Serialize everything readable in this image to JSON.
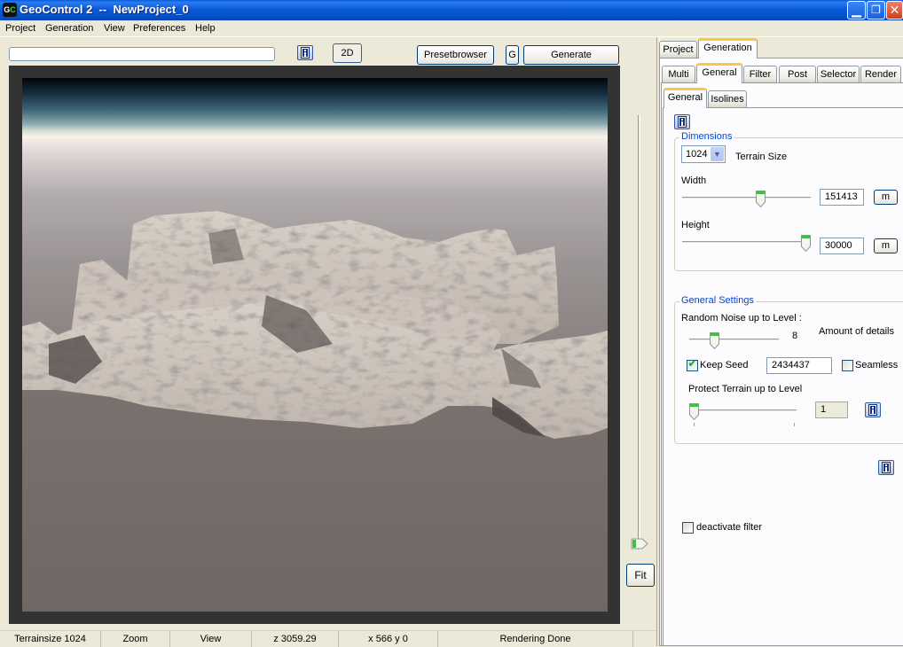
{
  "window": {
    "title": "GeoControl 2  --  NewProject_0",
    "app_icon": "geocontrol-logo-icon",
    "controls": [
      "minimize-icon",
      "restore-icon",
      "close-icon"
    ]
  },
  "menu": {
    "items": [
      {
        "label": "Project"
      },
      {
        "label": "Generation"
      },
      {
        "label": "View"
      },
      {
        "label": "Preferences"
      },
      {
        "label": "Help"
      }
    ]
  },
  "toolbar": {
    "progress_value": "",
    "info_icon": "info-icon",
    "mode_2d_label": "2D",
    "presetbrowser_label": "Presetbrowser",
    "g_label": "G",
    "generate_label": "Generate"
  },
  "viewport": {
    "fit_label": "Fit",
    "colors": {
      "frame": "#333333",
      "sky_top": "#02050c",
      "horizon": "#f8f2ea",
      "ground": "#6f6764",
      "terrain_light": "#d9d0c8",
      "terrain_shadow": "#5a5250"
    }
  },
  "panel": {
    "top_tabs": [
      {
        "label": "Project",
        "active": false
      },
      {
        "label": "Generation",
        "active": true
      }
    ],
    "sub_tabs": [
      {
        "label": "Multi",
        "active": false
      },
      {
        "label": "General",
        "active": true
      },
      {
        "label": "Filter",
        "active": false
      },
      {
        "label": "Post",
        "active": false
      },
      {
        "label": "Selector",
        "active": false
      },
      {
        "label": "Render",
        "active": false
      }
    ],
    "inner_tabs": [
      {
        "label": "General",
        "active": true
      },
      {
        "label": "Isolines",
        "active": false
      }
    ],
    "dimensions": {
      "title": "Dimensions",
      "terrain_size_value": "1024",
      "terrain_size_label": "Terrain Size",
      "width_label": "Width",
      "width_value": "151413",
      "width_slider_fraction": 0.62,
      "width_unit": "m",
      "height_label": "Height",
      "height_value": "30000",
      "height_slider_fraction": 1.0,
      "height_unit": "m"
    },
    "general_settings": {
      "title": "General Settings",
      "random_noise_label": "Random Noise up to Level :",
      "random_noise_value": "8",
      "random_noise_slider_fraction": 0.25,
      "amount_of_details_label": "Amount of details",
      "keep_seed_label": "Keep Seed",
      "keep_seed_checked": true,
      "seed_value": "2434437",
      "seamless_label": "Seamless",
      "seamless_checked": false,
      "protect_terrain_label": "Protect Terrain up to Level",
      "protect_terrain_value": "1",
      "protect_terrain_slider_fraction": 0.0
    },
    "deactivate_filter_label": "deactivate filter",
    "deactivate_filter_checked": false
  },
  "statusbar": {
    "cells": [
      {
        "label": "Terrainsize 1024"
      },
      {
        "label": "Zoom"
      },
      {
        "label": "View"
      },
      {
        "label": "z 3059.29"
      },
      {
        "label": "x 566 y 0"
      },
      {
        "label": "Rendering Done"
      }
    ]
  }
}
